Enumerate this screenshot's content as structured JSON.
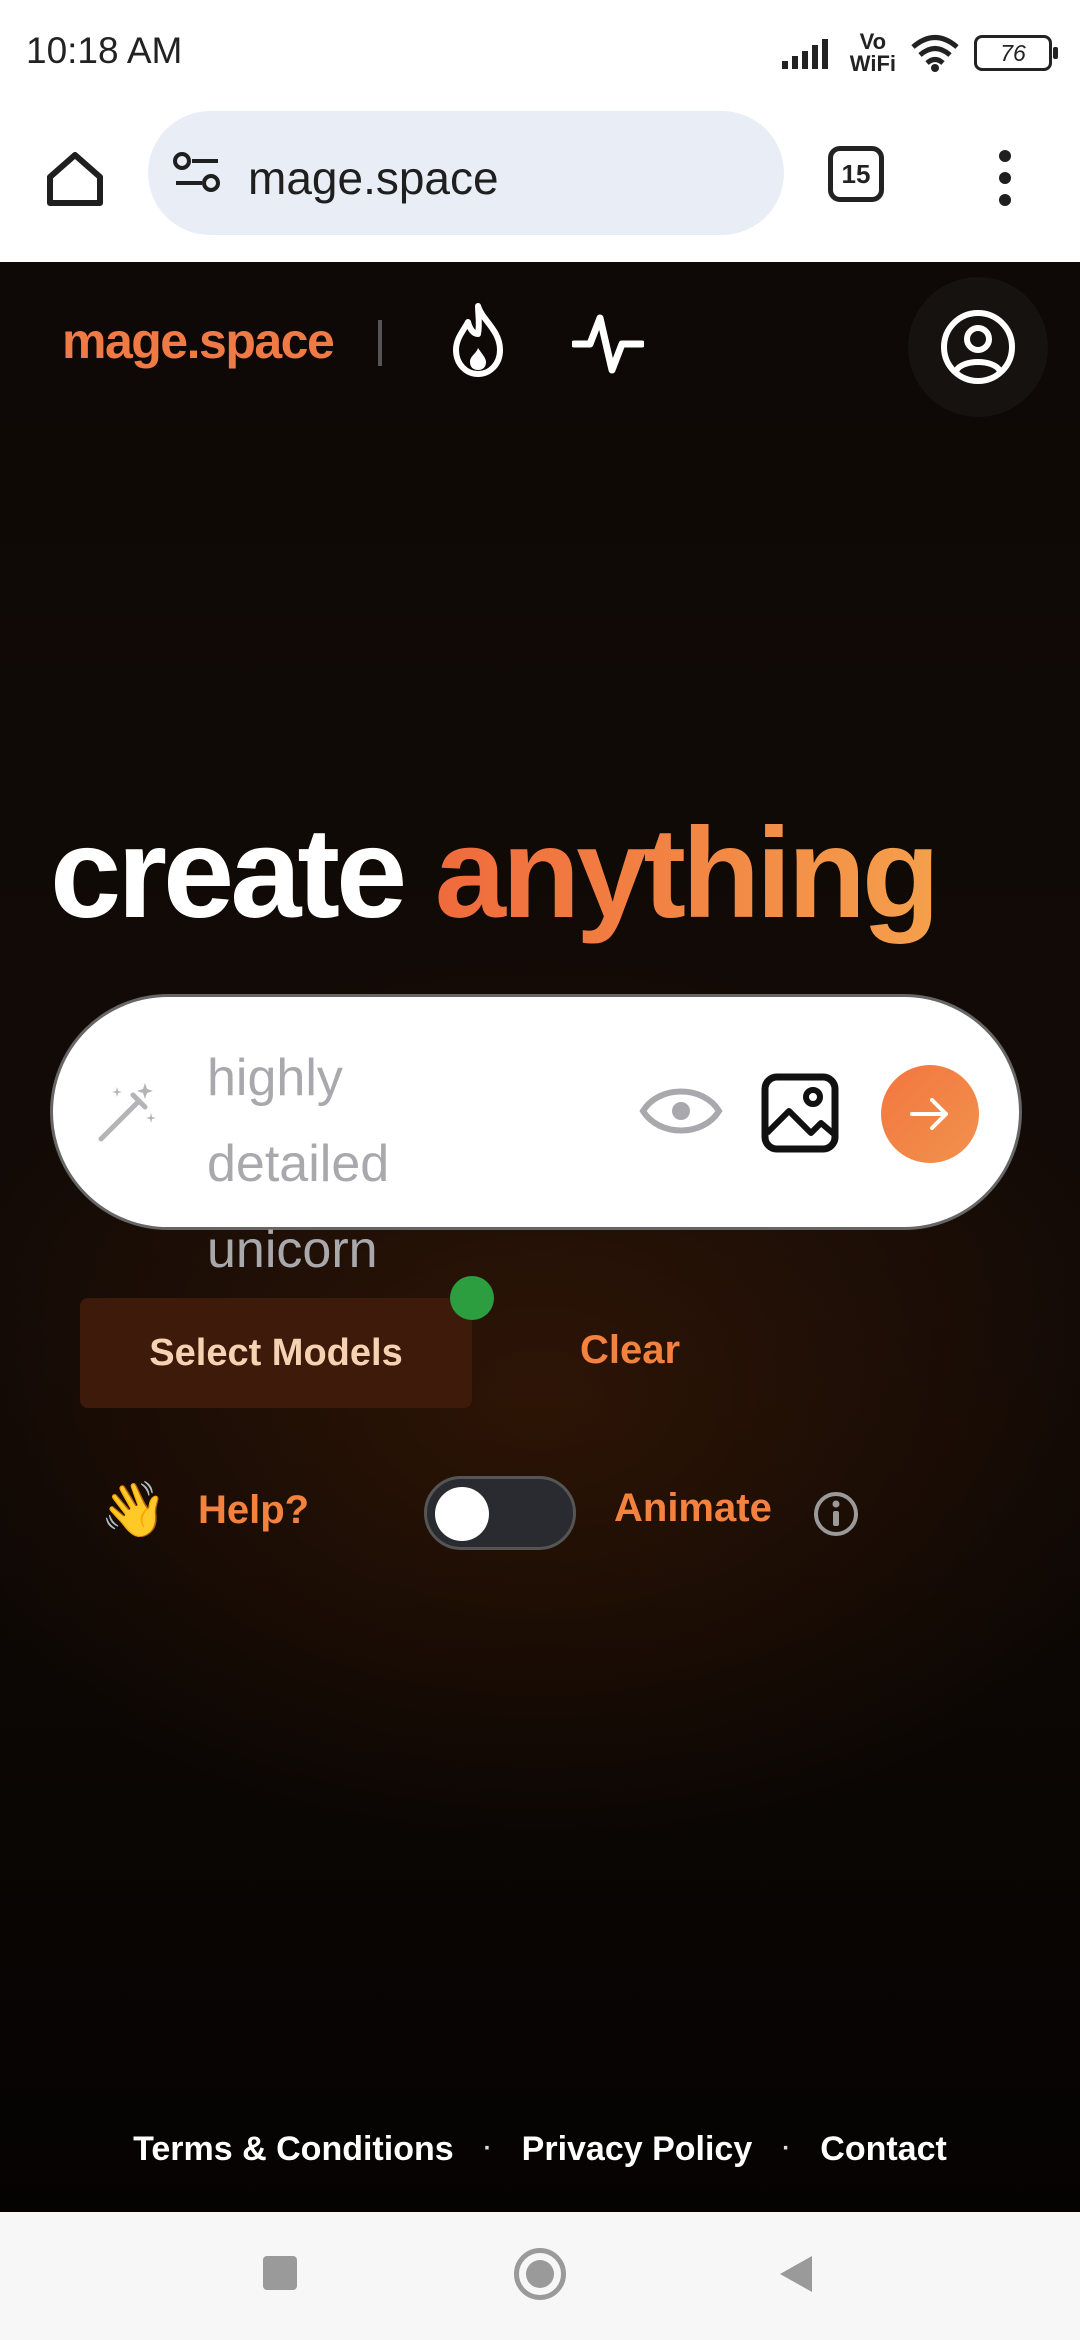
{
  "status_bar": {
    "time": "10:18 AM",
    "network_label": "Vo\nWiFi",
    "battery": "76"
  },
  "browser": {
    "url": "mage.space",
    "tab_count": "15"
  },
  "site": {
    "logo": "mage.space",
    "headline_part1": "create",
    "headline_part2": "anything",
    "prompt_placeholder": "highly detailed unicorn",
    "select_models_label": "Select Models",
    "clear_label": "Clear",
    "help_emoji": "👋",
    "help_label": "Help?",
    "animate_label": "Animate",
    "animate_enabled": false,
    "footer": {
      "terms": "Terms & Conditions",
      "separator": "·",
      "privacy": "Privacy Policy",
      "contact": "Contact"
    }
  },
  "colors": {
    "accent": "#f3823f",
    "models_button_bg": "#3d1a09",
    "status_dot": "#2c9e3f"
  },
  "icons": [
    "home-icon",
    "tune-icon",
    "tabs-icon",
    "more-vert-icon",
    "fire-icon",
    "activity-icon",
    "account-circle-icon",
    "magic-wand-icon",
    "eye-icon",
    "image-icon",
    "arrow-right-icon",
    "info-icon"
  ]
}
